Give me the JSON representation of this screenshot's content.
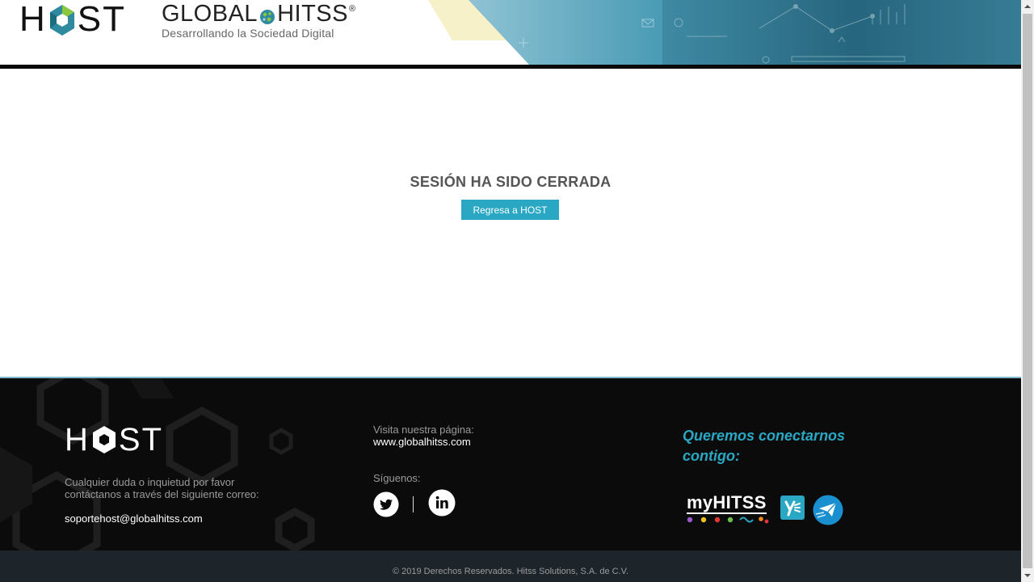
{
  "header": {
    "host_logo": {
      "left": "H",
      "right": "ST"
    },
    "globalhitss": {
      "word_left": "GLOBAL",
      "word_right": "HITSS",
      "registered": "®",
      "tagline": "Desarrollando la Sociedad Digital"
    }
  },
  "main": {
    "title": "SESIÓN HA SIDO CERRADA",
    "button_label": "Regresa a HOST"
  },
  "footer": {
    "host_logo": {
      "left": "H",
      "right": "ST"
    },
    "help_text": "Cualquier duda o inquietud por favor contáctanos a través del siguiente correo:",
    "email": "soportehost@globalhitss.com",
    "visit_label": "Visita nuestra página:",
    "visit_link": "www.globalhitss.com",
    "follow_label": "Síguenos:",
    "social": [
      "twitter-icon",
      "linkedin-icon"
    ],
    "connect_text": "Queremos conectarnos contigo:",
    "apps": {
      "myhitss": "myHITSS",
      "icons": [
        "myhitss-logo",
        "yammer-icon",
        "mail-icon"
      ]
    }
  },
  "copyright": "© 2019 Derechos Reservados. Hitss Solutions, S.A. de C.V.",
  "colors": {
    "accent": "#2aa7c3",
    "footer_bg": "#0b0b0b",
    "copyright_bg": "#1d252b",
    "logo_teal": "#2f8aa0",
    "logo_green": "#8cc63f"
  }
}
